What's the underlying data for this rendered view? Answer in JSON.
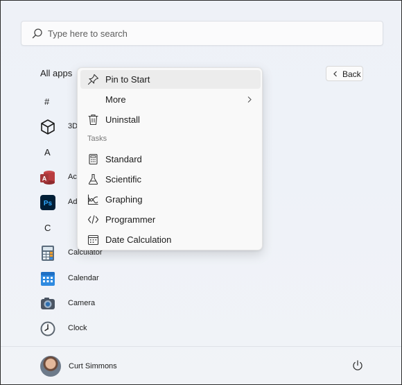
{
  "search": {
    "placeholder": "Type here to search",
    "icon": "search-icon"
  },
  "all_apps": {
    "title": "All apps",
    "back_label": "Back"
  },
  "groups": [
    {
      "letter": "#"
    },
    {
      "letter": "A"
    },
    {
      "letter": "C"
    }
  ],
  "apps": [
    {
      "label": "3D",
      "icon": "cube-icon"
    },
    {
      "label": "Ac",
      "icon": "access-icon"
    },
    {
      "label": "Ad",
      "icon": "photoshop-icon"
    },
    {
      "label": "Calculator",
      "icon": "calculator-icon"
    },
    {
      "label": "Calendar",
      "icon": "calendar-icon"
    },
    {
      "label": "Camera",
      "icon": "camera-icon"
    },
    {
      "label": "Clock",
      "icon": "clock-icon"
    }
  ],
  "context_menu": {
    "pin_to_start": "Pin to Start",
    "more": "More",
    "uninstall": "Uninstall",
    "tasks_header": "Tasks",
    "tasks": [
      "Standard",
      "Scientific",
      "Graphing",
      "Programmer",
      "Date Calculation"
    ]
  },
  "user": {
    "name": "Curt Simmons"
  },
  "colors": {
    "access": "#a4373a",
    "photoshop": "#001e36",
    "photoshop_text": "#31a8ff",
    "accent": "#0067c0"
  }
}
